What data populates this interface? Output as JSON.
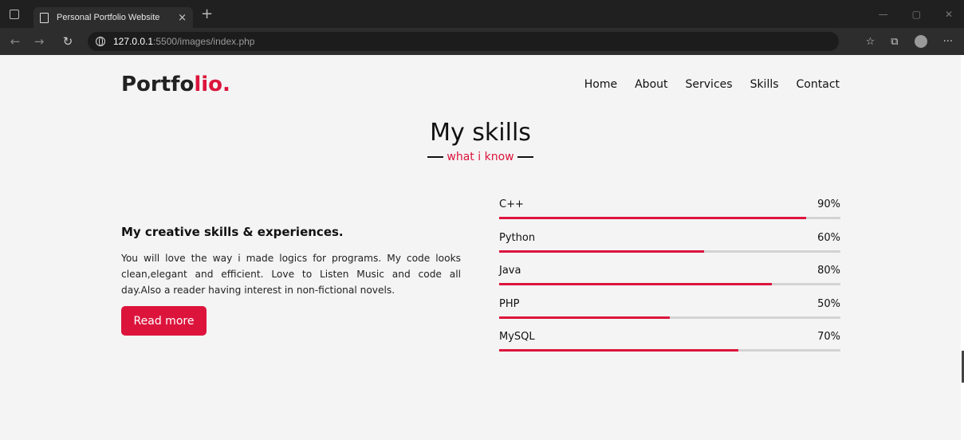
{
  "browser": {
    "tab_title": "Personal Portfolio Website",
    "tab_close": "×",
    "new_tab": "+",
    "url_host": "127.0.0.1",
    "url_path": ":5500/images/index.php"
  },
  "header": {
    "logo_main": "Portfo",
    "logo_accent": "lio."
  },
  "nav": [
    "Home",
    "About",
    "Services",
    "Skills",
    "Contact"
  ],
  "section": {
    "title": "My skills",
    "subtitle": "what i know"
  },
  "about": {
    "heading": "My creative skills & experiences.",
    "text": "You will love the way i made logics for programs. My code looks clean,elegant and efficient. Love to Listen Music and code all day.Also a reader having interest in non-fictional novels.",
    "button": "Read more"
  },
  "skills": [
    {
      "name": "C++",
      "percent_label": "90%",
      "value": 0.9
    },
    {
      "name": "Python",
      "percent_label": "60%",
      "value": 0.6
    },
    {
      "name": "Java",
      "percent_label": "80%",
      "value": 0.8
    },
    {
      "name": "PHP",
      "percent_label": "50%",
      "value": 0.5
    },
    {
      "name": "MySQL",
      "percent_label": "70%",
      "value": 0.7
    }
  ],
  "colors": {
    "accent": "#dc143c",
    "track": "#d3d3d3"
  }
}
